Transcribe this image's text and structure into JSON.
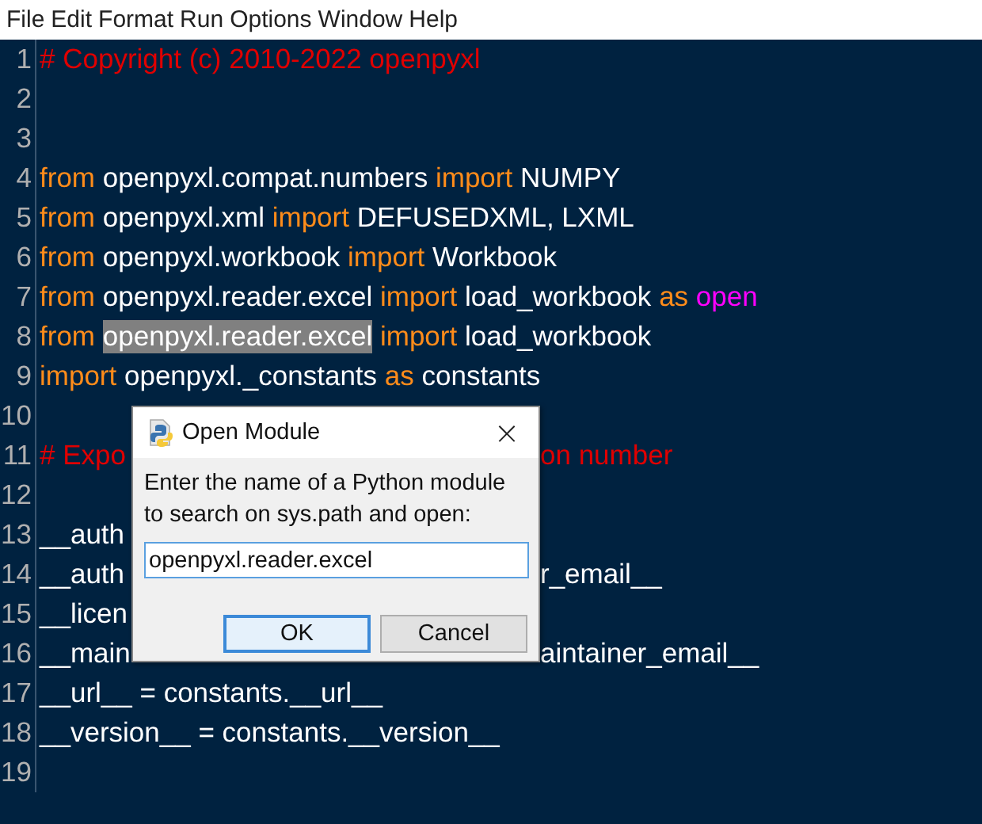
{
  "menu": [
    "File",
    "Edit",
    "Format",
    "Run",
    "Options",
    "Window",
    "Help"
  ],
  "lines": [
    {
      "number": "1",
      "segments": [
        {
          "kind": "comment",
          "text": "# Copyright (c) 2010-2022 openpyxl"
        }
      ]
    },
    {
      "number": "2"
    },
    {
      "number": "3"
    },
    {
      "number": "4",
      "segments": [
        {
          "kind": "keyword",
          "text": "from"
        },
        {
          "kind": "plain",
          "text": " openpyxl.compat.numbers "
        },
        {
          "kind": "keyword",
          "text": "import"
        },
        {
          "kind": "plain",
          "text": " NUMPY"
        }
      ]
    },
    {
      "number": "5",
      "segments": [
        {
          "kind": "keyword",
          "text": "from"
        },
        {
          "kind": "plain",
          "text": " openpyxl.xml "
        },
        {
          "kind": "keyword",
          "text": "import"
        },
        {
          "kind": "plain",
          "text": " DEFUSEDXML, LXML"
        }
      ]
    },
    {
      "number": "6",
      "segments": [
        {
          "kind": "keyword",
          "text": "from"
        },
        {
          "kind": "plain",
          "text": " openpyxl.workbook "
        },
        {
          "kind": "keyword",
          "text": "import"
        },
        {
          "kind": "plain",
          "text": " Workbook"
        }
      ]
    },
    {
      "number": "7",
      "segments": [
        {
          "kind": "keyword",
          "text": "from"
        },
        {
          "kind": "plain",
          "text": " openpyxl.reader.excel "
        },
        {
          "kind": "keyword",
          "text": "import"
        },
        {
          "kind": "plain",
          "text": " load_workbook "
        },
        {
          "kind": "keyword",
          "text": "as "
        },
        {
          "kind": "builtin",
          "text": "open"
        }
      ]
    },
    {
      "number": "8",
      "segments": [
        {
          "kind": "keyword",
          "text": "from "
        },
        {
          "kind": "selection",
          "text": "openpyxl.reader.excel"
        },
        {
          "kind": "keyword",
          "text": " import"
        },
        {
          "kind": "plain",
          "text": " load_workbook"
        }
      ]
    },
    {
      "number": "9",
      "segments": [
        {
          "kind": "keyword",
          "text": "import"
        },
        {
          "kind": "plain",
          "text": " openpyxl._constants "
        },
        {
          "kind": "keyword",
          "text": "as"
        },
        {
          "kind": "plain",
          "text": " constants"
        }
      ]
    },
    {
      "number": "10"
    },
    {
      "number": "11",
      "segments": [
        {
          "kind": "comment",
          "text": "# Expo"
        },
        {
          "kind": "hidden"
        },
        {
          "kind": "comment",
          "text": "on number"
        }
      ]
    },
    {
      "number": "12"
    },
    {
      "number": "13",
      "segments": [
        {
          "kind": "plain",
          "text": "__auth"
        },
        {
          "kind": "hidden"
        }
      ]
    },
    {
      "number": "14",
      "segments": [
        {
          "kind": "plain",
          "text": "__auth"
        },
        {
          "kind": "hidden"
        },
        {
          "kind": "plain",
          "text": "r_email__"
        }
      ]
    },
    {
      "number": "15",
      "segments": [
        {
          "kind": "plain",
          "text": "__licen"
        },
        {
          "kind": "hidden"
        }
      ]
    },
    {
      "number": "16",
      "segments": [
        {
          "kind": "plain",
          "text": "__main"
        },
        {
          "kind": "hidden"
        },
        {
          "kind": "plain",
          "text": "aintainer_email__"
        }
      ]
    },
    {
      "number": "17",
      "segments": [
        {
          "kind": "plain",
          "text": "__url__ = constants.__url__"
        }
      ]
    },
    {
      "number": "18",
      "segments": [
        {
          "kind": "plain",
          "text": "__version__ = constants.__version__"
        }
      ]
    },
    {
      "number": "19"
    }
  ],
  "dialog": {
    "title": "Open Module",
    "close": "×",
    "prompt": [
      "Enter the name of a Python module",
      "to search on sys.path and open:"
    ],
    "input": {
      "value": "openpyxl.reader.excel"
    },
    "buttons": [
      {
        "label": "OK",
        "default": true
      },
      {
        "label": "Cancel",
        "default": false
      }
    ]
  }
}
